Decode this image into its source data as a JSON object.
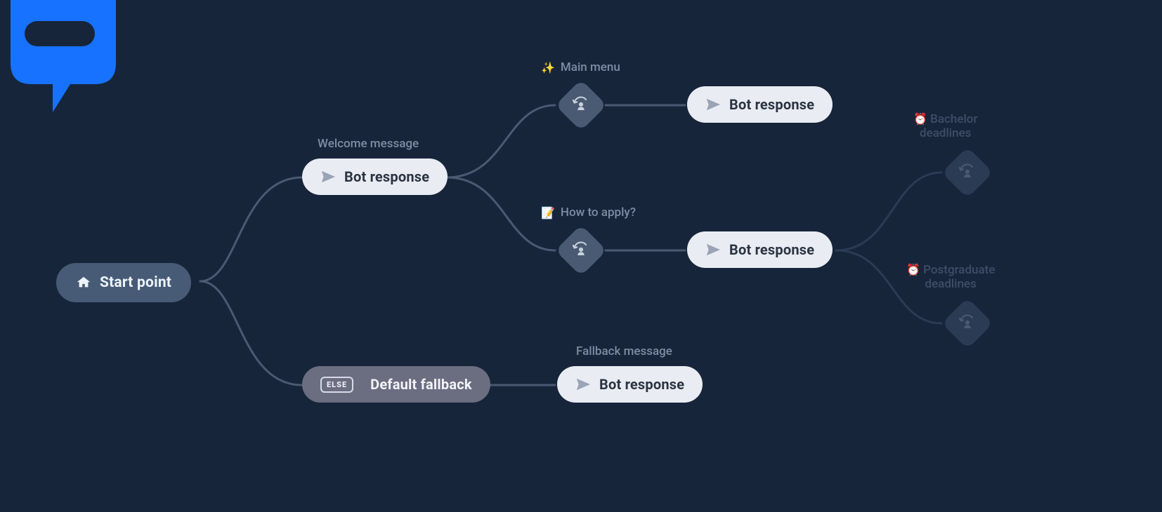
{
  "colors": {
    "bg": "#17253a",
    "connector": "#4a5a72",
    "connector_faded": "#2b3b53",
    "pill_light_bg": "#e9edf3",
    "pill_light_fg": "#2b3342",
    "pill_start_bg": "#475b76",
    "pill_fallback_bg": "#6b6d80",
    "caption": "#7e8ca3",
    "logo_blue": "#1672ff"
  },
  "nodes": {
    "start": {
      "label": "Start point"
    },
    "welcome": {
      "caption": "Welcome message",
      "label": "Bot response"
    },
    "main_menu": {
      "caption_emoji": "✨",
      "caption": "Main menu",
      "response_label": "Bot response"
    },
    "how_to_apply": {
      "caption_emoji": "📝",
      "caption": "How to apply?",
      "response_label": "Bot response"
    },
    "fallback": {
      "else_badge": "ELSE",
      "label": "Default fallback",
      "caption": "Fallback message",
      "response_label": "Bot response"
    },
    "bachelor": {
      "caption_emoji": "⏰",
      "caption_line1": "Bachelor",
      "caption_line2": "deadlines"
    },
    "postgrad": {
      "caption_emoji": "⏰",
      "caption_line1": "Postgraduate",
      "caption_line2": "deadlines"
    }
  }
}
